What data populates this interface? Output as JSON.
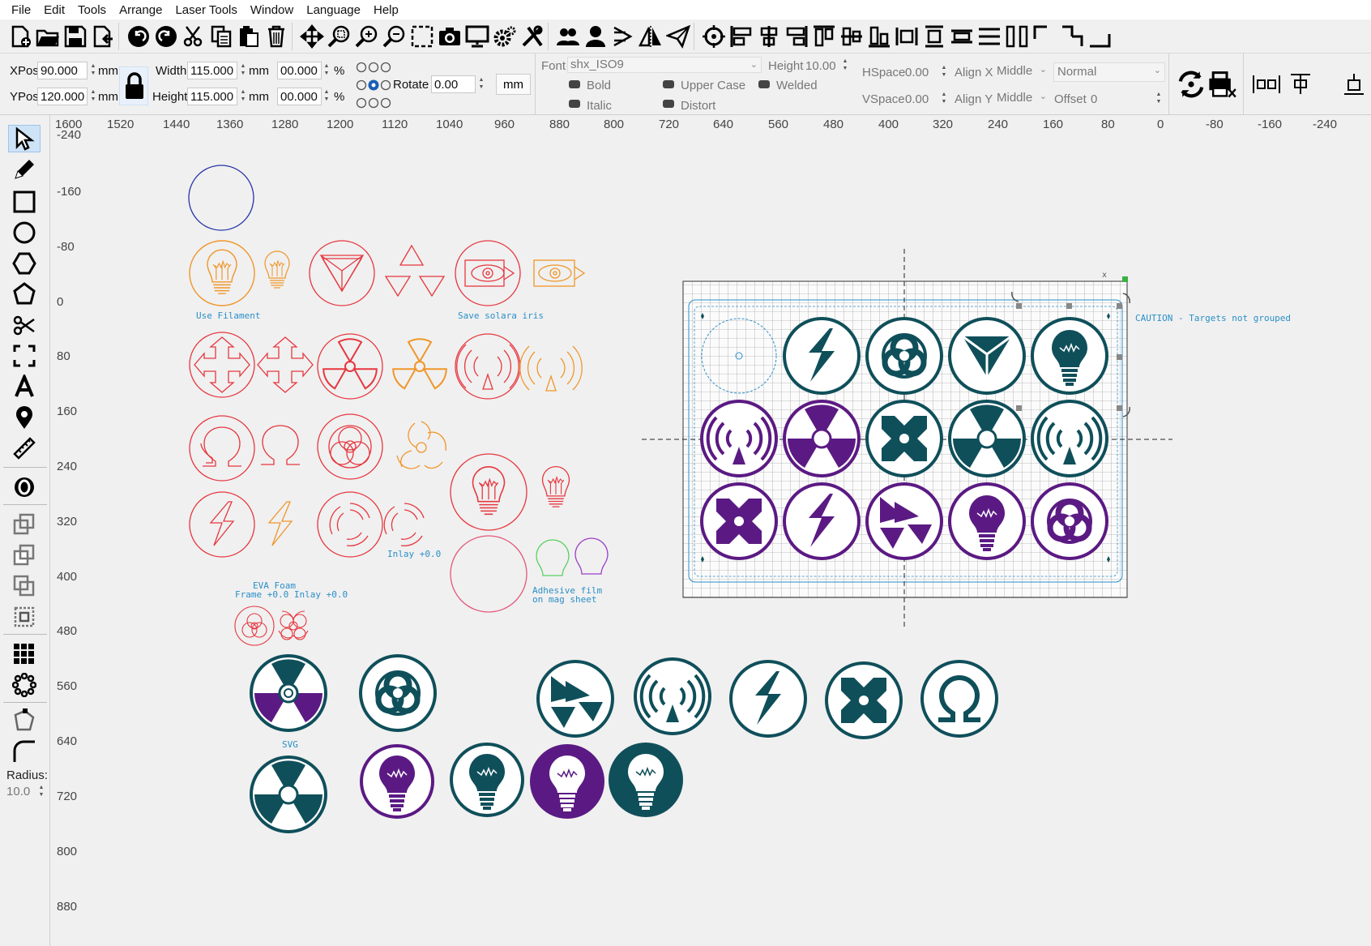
{
  "menu": [
    "File",
    "Edit",
    "Tools",
    "Arrange",
    "Laser Tools",
    "Window",
    "Language",
    "Help"
  ],
  "toolbar_icons": [
    "new-file-icon",
    "open-folder-icon",
    "save-icon",
    "import-icon",
    "undo-icon",
    "redo-icon",
    "cut-icon",
    "copy-icon",
    "paste-icon",
    "delete-icon",
    "move-icon",
    "zoom-selection-icon",
    "zoom-in-icon",
    "zoom-out-icon",
    "select-frame-icon",
    "camera-icon",
    "monitor-icon",
    "settings-icon",
    "tools-icon",
    "group-icon",
    "user-icon",
    "flip-icon",
    "mirror-icon",
    "send-icon",
    "target-icon",
    "align-left-icon",
    "align-center-icon",
    "align-right-icon",
    "align-top-icon",
    "align-middle-icon",
    "align-bottom-icon",
    "distribute-h-icon",
    "distribute-v-icon",
    "dock-icon",
    "space-icon",
    "spread-icon",
    "corner-icon",
    "corner-2-icon",
    "corner-3-icon"
  ],
  "props": {
    "xpos_label": "XPos",
    "xpos": "90.000",
    "ypos_label": "YPos",
    "ypos": "120.000",
    "mm": "mm",
    "width_label": "Width",
    "width": "115.000",
    "height_label": "Height",
    "height": "115.000",
    "pct_w": "00.000",
    "pct_h": "00.000",
    "pct": "%",
    "rotate_label": "Rotate",
    "rotate": "0.00",
    "unit_button": "mm",
    "font_label": "Font",
    "font": "shx_ISO9",
    "text_height_label": "Height",
    "text_height": "10.00",
    "bold": "Bold",
    "upper_case": "Upper Case",
    "welded": "Welded",
    "italic": "Italic",
    "distort": "Distort",
    "hspace_label": "HSpace",
    "hspace": "0.00",
    "vspace_label": "VSpace",
    "vspace": "0.00",
    "align_x_label": "Align X",
    "align_x": "Middle",
    "align_y_label": "Align Y",
    "align_y": "Middle",
    "mode": "Normal",
    "offset_label": "Offset",
    "offset": "0"
  },
  "left_tools": [
    "select-arrow-icon",
    "pencil-icon",
    "rectangle-icon",
    "ellipse-icon",
    "hexagon-icon",
    "polygon-icon",
    "scissors-icon",
    "frame-icon",
    "text-icon",
    "position-pin-icon",
    "measure-icon",
    "offset-icon",
    "boolean-union-icon",
    "boolean-subtract-icon",
    "boolean-intersect-icon",
    "weld-icon",
    "grid-array-icon",
    "circular-array-icon",
    "node-edit-icon",
    "corner-radius-icon"
  ],
  "radius_label": "Radius:",
  "radius_value": "10.0",
  "hruler": [
    "1600",
    "1520",
    "1440",
    "1360",
    "1280",
    "1200",
    "1120",
    "1040",
    "960",
    "880",
    "800",
    "720",
    "640",
    "560",
    "480",
    "400",
    "320",
    "240",
    "160",
    "80",
    "0",
    "-80",
    "-160",
    "-240"
  ],
  "vruler": [
    "-240",
    "-160",
    "-80",
    "0",
    "80",
    "160",
    "240",
    "320",
    "400",
    "480",
    "560",
    "640",
    "720",
    "800",
    "880"
  ],
  "canvas_labels": {
    "use_filament": "Use Filament",
    "save_eyes": "Save solara iris",
    "inlay": "Inlay +0.0",
    "eva_foam_1": "EVA Foam",
    "eva_foam_2": "Frame +0.0  Inlay +0.0",
    "adhesive_1": "Adhesive film",
    "adhesive_2": "on mag sheet",
    "svg_label": "SVG",
    "caution": "CAUTION - Targets not grouped",
    "sel_x": "x"
  },
  "colors": {
    "orange": "#f0962a",
    "red": "#e6373f",
    "teal": "#0f4f5a",
    "purple": "#5b1a83",
    "blue_circle": "#2733a8",
    "cyan_text": "#2a8fc8",
    "green": "#59d05f",
    "lavender": "#9b3fc8"
  }
}
